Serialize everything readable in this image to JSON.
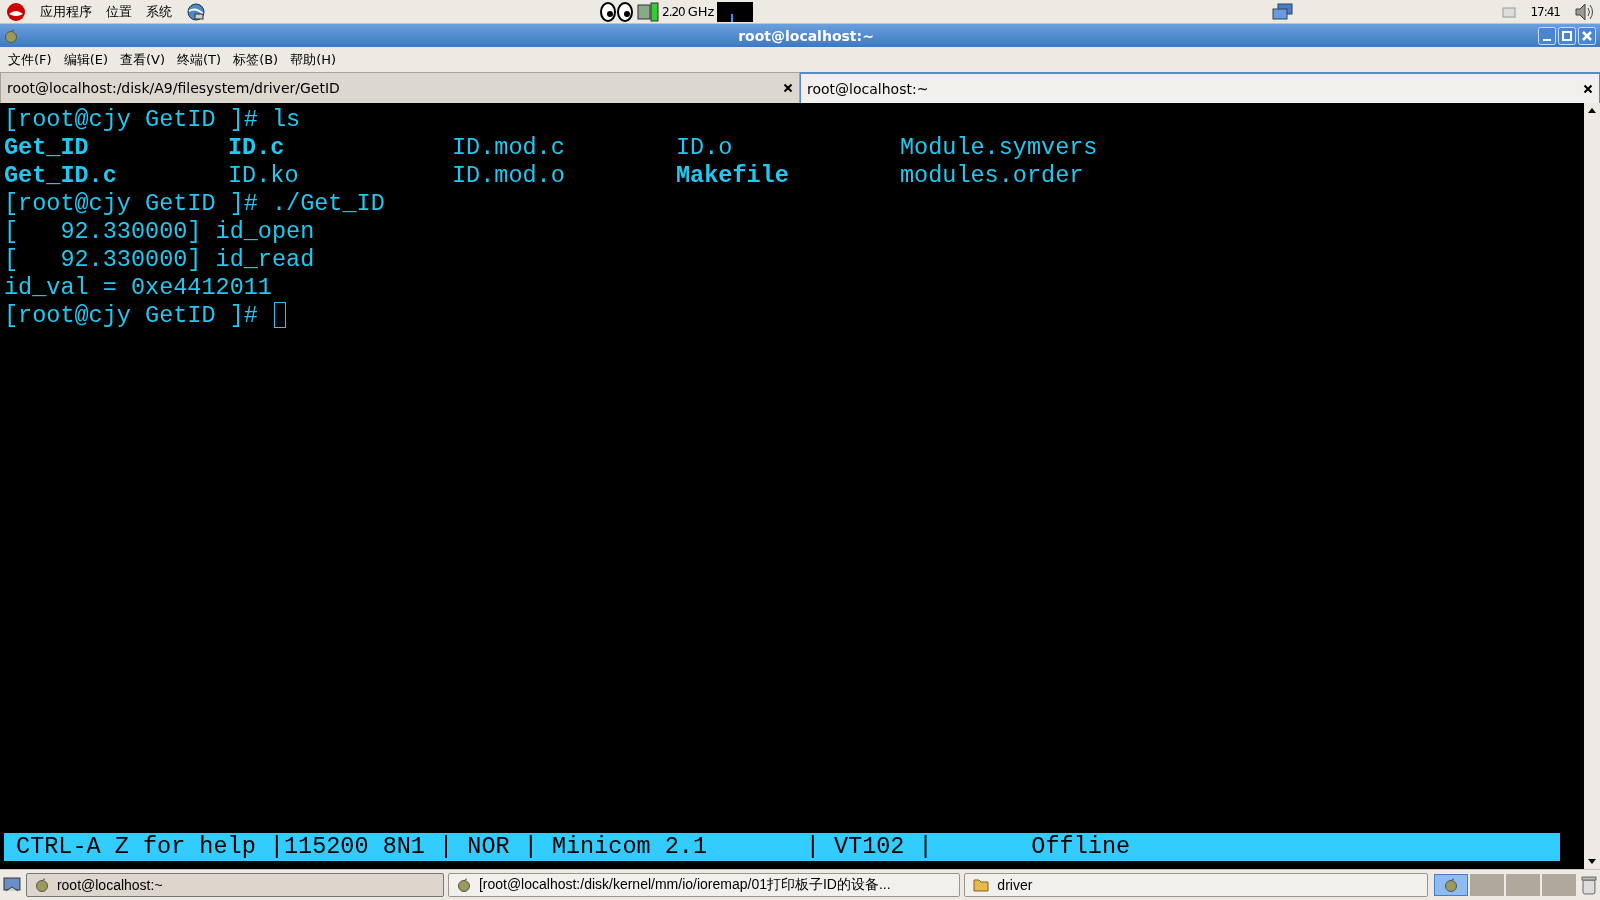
{
  "top_panel": {
    "menus": [
      "应用程序",
      "位置",
      "系统"
    ],
    "cpu_freq": "2.20",
    "cpu_unit": "GHz",
    "clock": "17:41"
  },
  "window": {
    "title": "root@localhost:~",
    "menu": [
      "文件(F)",
      "编辑(E)",
      "查看(V)",
      "终端(T)",
      "标签(B)",
      "帮助(H)"
    ],
    "tabs": [
      {
        "label": "root@localhost:/disk/A9/filesystem/driver/GetID",
        "selected": false
      },
      {
        "label": "root@localhost:~",
        "selected": true
      }
    ]
  },
  "terminal": {
    "lines": [
      {
        "kind": "text",
        "text": "[root@cjy GetID ]# ls",
        "cursor": false
      },
      {
        "kind": "columns",
        "cells": [
          {
            "text": "Get_ID",
            "bold": true
          },
          {
            "text": "ID.c",
            "bold": true
          },
          {
            "text": "ID.mod.c",
            "bold": false
          },
          {
            "text": "ID.o",
            "bold": false
          },
          {
            "text": "Module.symvers",
            "bold": false
          }
        ]
      },
      {
        "kind": "columns",
        "cells": [
          {
            "text": "Get_ID.c",
            "bold": true
          },
          {
            "text": "ID.ko",
            "bold": false
          },
          {
            "text": "ID.mod.o",
            "bold": false
          },
          {
            "text": "Makefile",
            "bold": true
          },
          {
            "text": "modules.order",
            "bold": false
          }
        ]
      },
      {
        "kind": "text",
        "text": "[root@cjy GetID ]# ./Get_ID",
        "cursor": false
      },
      {
        "kind": "text",
        "text": "[   92.330000] id_open",
        "cursor": false
      },
      {
        "kind": "text",
        "text": "[   92.330000] id_read",
        "cursor": false
      },
      {
        "kind": "text",
        "text": "id_val = 0xe4412011",
        "cursor": false
      },
      {
        "kind": "text",
        "text": "[root@cjy GetID ]#",
        "cursor": true
      }
    ],
    "status_line": "CTRL-A Z for help |115200 8N1 | NOR | Minicom 2.1       | VT102 |       Offline"
  },
  "taskbar": {
    "tasks": [
      {
        "label": "root@localhost:~",
        "kind": "terminal",
        "selected": true
      },
      {
        "label": "[root@localhost:/disk/kernel/mm/io/ioremap/01打印板子ID的设备...",
        "kind": "terminal",
        "selected": false
      },
      {
        "label": "driver",
        "kind": "folder",
        "selected": false
      }
    ],
    "workspaces": [
      {
        "selected": true
      },
      {
        "selected": false
      },
      {
        "selected": false
      },
      {
        "selected": false
      }
    ]
  }
}
